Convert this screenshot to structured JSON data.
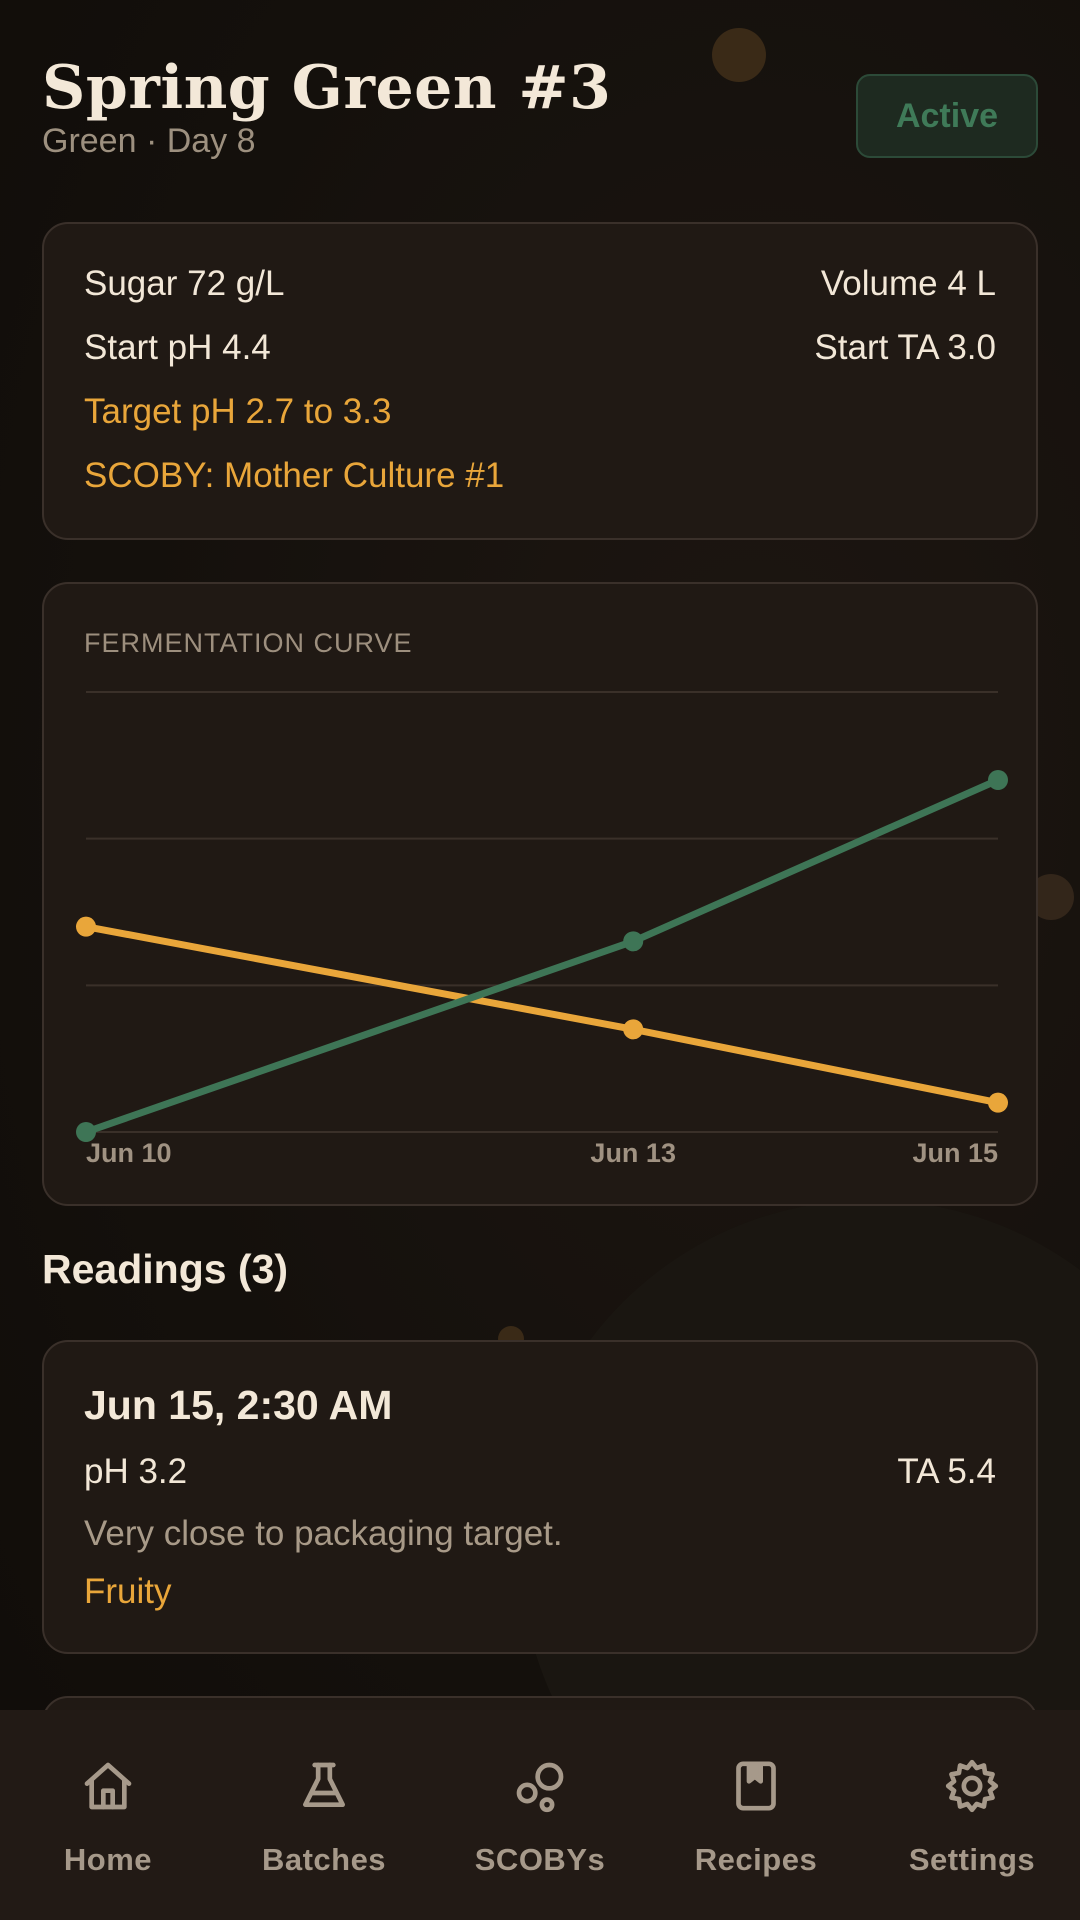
{
  "header": {
    "title": "Spring Green #3",
    "subtitle": "Green · Day 8",
    "status": "Active"
  },
  "info": {
    "sugar": "Sugar 72 g/L",
    "volume": "Volume 4 L",
    "start_ph": "Start pH 4.4",
    "start_ta": "Start TA 3.0",
    "target_ph": "Target pH 2.7 to 3.3",
    "scoby": "SCOBY: Mother Culture #1"
  },
  "chart": {
    "label": "FERMENTATION CURVE"
  },
  "chart_data": {
    "type": "line",
    "x": [
      "Jun 10",
      "Jun 13",
      "Jun 15"
    ],
    "series": [
      {
        "values": [
          4.4,
          3.7,
          3.2
        ],
        "color": "#e9a63a"
      },
      {
        "values": [
          3.0,
          4.3,
          5.4
        ],
        "color": "#3e7556"
      }
    ],
    "ylim": [
      3.0,
      6.0
    ],
    "grid": true
  },
  "readings": {
    "title": "Readings (3)",
    "items": [
      {
        "date": "Jun 15, 2:30 AM",
        "ph": "pH 3.2",
        "ta": "TA 5.4",
        "note": "Very close to packaging target.",
        "tag": "Fruity"
      }
    ]
  },
  "nav": {
    "items": [
      {
        "label": "Home",
        "icon": "home-icon"
      },
      {
        "label": "Batches",
        "icon": "flask-icon"
      },
      {
        "label": "SCOBYs",
        "icon": "scoby-icon"
      },
      {
        "label": "Recipes",
        "icon": "book-icon"
      },
      {
        "label": "Settings",
        "icon": "gear-icon"
      }
    ]
  },
  "colors": {
    "accent": "#e9a63a",
    "green": "#3e7556",
    "background": "#16110d",
    "card": "#201914"
  }
}
